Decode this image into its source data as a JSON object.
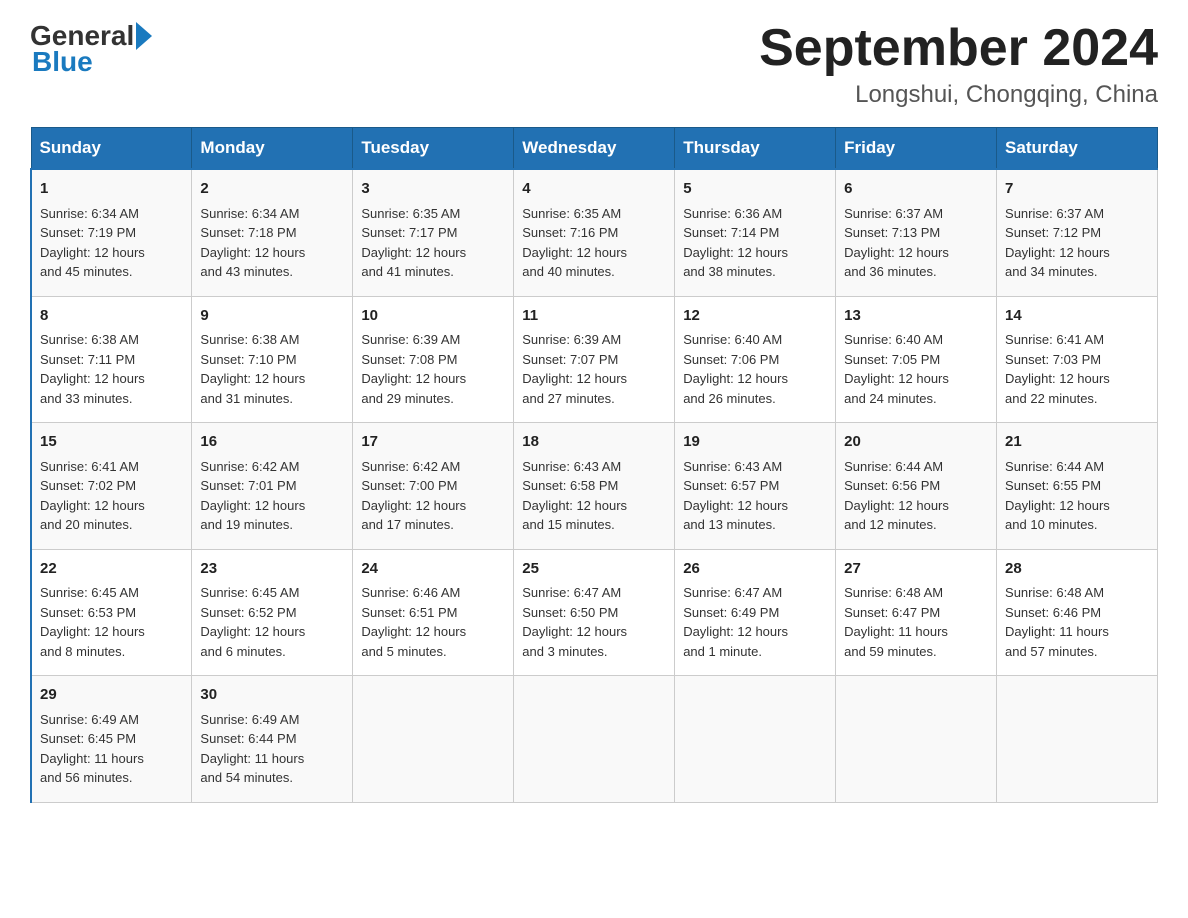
{
  "header": {
    "logo_general": "General",
    "logo_blue": "Blue",
    "month_title": "September 2024",
    "location": "Longshui, Chongqing, China"
  },
  "weekdays": [
    "Sunday",
    "Monday",
    "Tuesday",
    "Wednesday",
    "Thursday",
    "Friday",
    "Saturday"
  ],
  "weeks": [
    [
      {
        "day": "1",
        "info": "Sunrise: 6:34 AM\nSunset: 7:19 PM\nDaylight: 12 hours\nand 45 minutes."
      },
      {
        "day": "2",
        "info": "Sunrise: 6:34 AM\nSunset: 7:18 PM\nDaylight: 12 hours\nand 43 minutes."
      },
      {
        "day": "3",
        "info": "Sunrise: 6:35 AM\nSunset: 7:17 PM\nDaylight: 12 hours\nand 41 minutes."
      },
      {
        "day": "4",
        "info": "Sunrise: 6:35 AM\nSunset: 7:16 PM\nDaylight: 12 hours\nand 40 minutes."
      },
      {
        "day": "5",
        "info": "Sunrise: 6:36 AM\nSunset: 7:14 PM\nDaylight: 12 hours\nand 38 minutes."
      },
      {
        "day": "6",
        "info": "Sunrise: 6:37 AM\nSunset: 7:13 PM\nDaylight: 12 hours\nand 36 minutes."
      },
      {
        "day": "7",
        "info": "Sunrise: 6:37 AM\nSunset: 7:12 PM\nDaylight: 12 hours\nand 34 minutes."
      }
    ],
    [
      {
        "day": "8",
        "info": "Sunrise: 6:38 AM\nSunset: 7:11 PM\nDaylight: 12 hours\nand 33 minutes."
      },
      {
        "day": "9",
        "info": "Sunrise: 6:38 AM\nSunset: 7:10 PM\nDaylight: 12 hours\nand 31 minutes."
      },
      {
        "day": "10",
        "info": "Sunrise: 6:39 AM\nSunset: 7:08 PM\nDaylight: 12 hours\nand 29 minutes."
      },
      {
        "day": "11",
        "info": "Sunrise: 6:39 AM\nSunset: 7:07 PM\nDaylight: 12 hours\nand 27 minutes."
      },
      {
        "day": "12",
        "info": "Sunrise: 6:40 AM\nSunset: 7:06 PM\nDaylight: 12 hours\nand 26 minutes."
      },
      {
        "day": "13",
        "info": "Sunrise: 6:40 AM\nSunset: 7:05 PM\nDaylight: 12 hours\nand 24 minutes."
      },
      {
        "day": "14",
        "info": "Sunrise: 6:41 AM\nSunset: 7:03 PM\nDaylight: 12 hours\nand 22 minutes."
      }
    ],
    [
      {
        "day": "15",
        "info": "Sunrise: 6:41 AM\nSunset: 7:02 PM\nDaylight: 12 hours\nand 20 minutes."
      },
      {
        "day": "16",
        "info": "Sunrise: 6:42 AM\nSunset: 7:01 PM\nDaylight: 12 hours\nand 19 minutes."
      },
      {
        "day": "17",
        "info": "Sunrise: 6:42 AM\nSunset: 7:00 PM\nDaylight: 12 hours\nand 17 minutes."
      },
      {
        "day": "18",
        "info": "Sunrise: 6:43 AM\nSunset: 6:58 PM\nDaylight: 12 hours\nand 15 minutes."
      },
      {
        "day": "19",
        "info": "Sunrise: 6:43 AM\nSunset: 6:57 PM\nDaylight: 12 hours\nand 13 minutes."
      },
      {
        "day": "20",
        "info": "Sunrise: 6:44 AM\nSunset: 6:56 PM\nDaylight: 12 hours\nand 12 minutes."
      },
      {
        "day": "21",
        "info": "Sunrise: 6:44 AM\nSunset: 6:55 PM\nDaylight: 12 hours\nand 10 minutes."
      }
    ],
    [
      {
        "day": "22",
        "info": "Sunrise: 6:45 AM\nSunset: 6:53 PM\nDaylight: 12 hours\nand 8 minutes."
      },
      {
        "day": "23",
        "info": "Sunrise: 6:45 AM\nSunset: 6:52 PM\nDaylight: 12 hours\nand 6 minutes."
      },
      {
        "day": "24",
        "info": "Sunrise: 6:46 AM\nSunset: 6:51 PM\nDaylight: 12 hours\nand 5 minutes."
      },
      {
        "day": "25",
        "info": "Sunrise: 6:47 AM\nSunset: 6:50 PM\nDaylight: 12 hours\nand 3 minutes."
      },
      {
        "day": "26",
        "info": "Sunrise: 6:47 AM\nSunset: 6:49 PM\nDaylight: 12 hours\nand 1 minute."
      },
      {
        "day": "27",
        "info": "Sunrise: 6:48 AM\nSunset: 6:47 PM\nDaylight: 11 hours\nand 59 minutes."
      },
      {
        "day": "28",
        "info": "Sunrise: 6:48 AM\nSunset: 6:46 PM\nDaylight: 11 hours\nand 57 minutes."
      }
    ],
    [
      {
        "day": "29",
        "info": "Sunrise: 6:49 AM\nSunset: 6:45 PM\nDaylight: 11 hours\nand 56 minutes."
      },
      {
        "day": "30",
        "info": "Sunrise: 6:49 AM\nSunset: 6:44 PM\nDaylight: 11 hours\nand 54 minutes."
      },
      {
        "day": "",
        "info": ""
      },
      {
        "day": "",
        "info": ""
      },
      {
        "day": "",
        "info": ""
      },
      {
        "day": "",
        "info": ""
      },
      {
        "day": "",
        "info": ""
      }
    ]
  ]
}
